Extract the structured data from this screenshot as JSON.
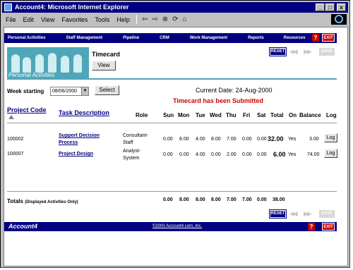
{
  "window": {
    "title": "Account4: Microsoft Internet Explorer",
    "controls": [
      "_",
      "□",
      "x"
    ]
  },
  "menubar": [
    "File",
    "Edit",
    "View",
    "Favorites",
    "Tools",
    "Help"
  ],
  "nav": [
    "Personal Activities",
    "Staff Management",
    "Pipeline",
    "CRM",
    "Work Management",
    "Reports",
    "Resources"
  ],
  "nav_help": "?",
  "nav_exit": "EXIT",
  "banner_label": "Personal Activities",
  "page_title": "Timecard",
  "buttons": {
    "view": "View",
    "reset": "RESET",
    "save": "SAVE",
    "select": "Select",
    "log": "Log"
  },
  "week_label": "Week starting",
  "week_value": "08/06/2000",
  "current_date": "Current Date: 24-Aug-2000",
  "status_message": "Timecard has been Submitted",
  "columns": {
    "project_code": "Project Code",
    "task_description": "Task Description",
    "role": "Role",
    "days": [
      "Sun",
      "Mon",
      "Tue",
      "Wed",
      "Thu",
      "Fri",
      "Sat"
    ],
    "total": "Total",
    "on": "On",
    "balance": "Balance",
    "log": "Log"
  },
  "rows": [
    {
      "code": "100002",
      "task_line1": "Support Decision",
      "task_line2": "Process",
      "role_line1": "Consultant-",
      "role_line2": "Staff",
      "days": [
        "0.00",
        "8.00",
        "4.00",
        "8.00",
        "7.00",
        "0.00",
        "0.00"
      ],
      "total": "32.00",
      "on": "Yes",
      "balance": "3.00"
    },
    {
      "code": "100007",
      "task_line1": "Project Design",
      "task_line2": "",
      "role_line1": "Analyst-",
      "role_line2": "System",
      "days": [
        "0.00",
        "0.00",
        "4.00",
        "0.00",
        "2.00",
        "0.00",
        "0.00"
      ],
      "total": "6.00",
      "on": "Yes",
      "balance": "74.00"
    }
  ],
  "totals": {
    "label": "Totals",
    "note": "(Displayed Activities Only)",
    "days": [
      "0.00",
      "8.00",
      "8.00",
      "8.00",
      "7.00",
      "7.00",
      "0.00"
    ],
    "total": "38.00"
  },
  "footer": {
    "brand": "Account4",
    "copyright": "©2000 Account4.com, Inc."
  },
  "colors": {
    "nav_bg": "#000080",
    "accent_teal": "#4fa6b8",
    "alert_red": "#d00000",
    "exit_red": "#cc0000"
  }
}
